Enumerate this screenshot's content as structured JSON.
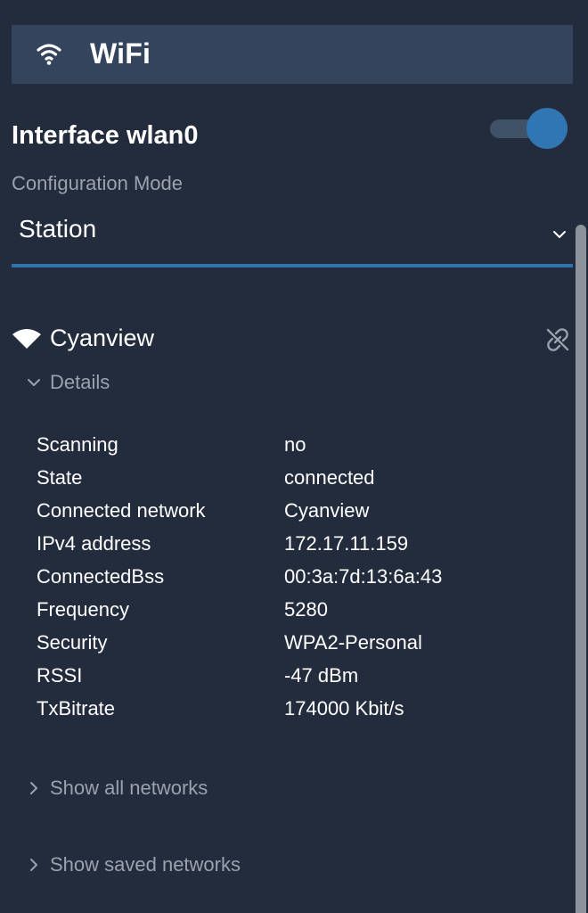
{
  "header": {
    "title": "WiFi",
    "icon": "wifi-icon"
  },
  "interface": {
    "title": "Interface wlan0",
    "enabled": true
  },
  "config": {
    "label": "Configuration Mode",
    "value": "Station"
  },
  "network": {
    "name": "Cyanview",
    "details_label": "Details",
    "details": [
      {
        "key": "Scanning",
        "value": "no"
      },
      {
        "key": "State",
        "value": "connected"
      },
      {
        "key": "Connected network",
        "value": "Cyanview"
      },
      {
        "key": "IPv4 address",
        "value": "172.17.11.159"
      },
      {
        "key": "ConnectedBss",
        "value": "00:3a:7d:13:6a:43"
      },
      {
        "key": "Frequency",
        "value": "5280"
      },
      {
        "key": "Security",
        "value": "WPA2-Personal"
      },
      {
        "key": "RSSI",
        "value": "-47 dBm"
      },
      {
        "key": "TxBitrate",
        "value": "174000 Kbit/s"
      }
    ]
  },
  "sections": {
    "show_all": "Show all networks",
    "show_saved": "Show saved networks"
  },
  "colors": {
    "background": "#232c3d",
    "header_bg": "#34445d",
    "accent": "#2e74ad",
    "muted_text": "#9aa2ae"
  }
}
